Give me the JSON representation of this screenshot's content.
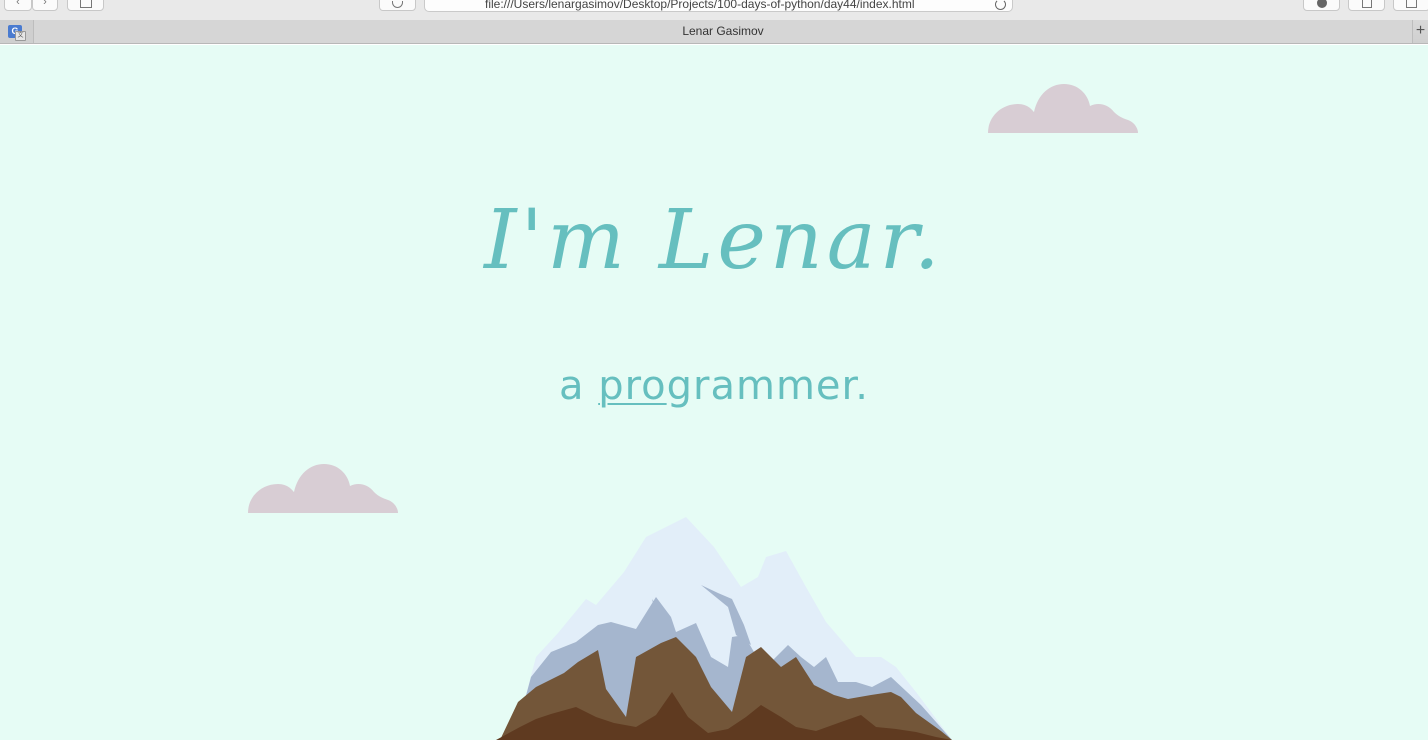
{
  "browser": {
    "url": "file:///Users/lenargasimov/Desktop/Projects/100-days-of-python/day44/index.html",
    "tab_title": "Lenar Gasimov",
    "new_tab_label": "+",
    "favicon_letter": "G"
  },
  "page": {
    "title": "I'm Lenar.",
    "subtitle_prefix": "a ",
    "subtitle_pro": "pro",
    "subtitle_suffix": "grammer.",
    "background_color": "#e6fcf5",
    "accent_color": "#66bfbf",
    "cloud_color": "#d8cdd4",
    "icons": [
      "cloud-icon",
      "cloud-icon",
      "mountain-illustration"
    ]
  }
}
